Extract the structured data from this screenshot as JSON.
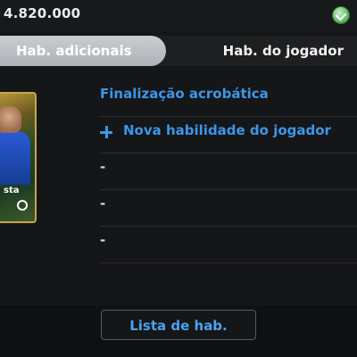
{
  "header": {
    "coins": "4.820.000",
    "coin_icon": "gp-coin-icon"
  },
  "tabs": [
    {
      "label": "Hab. adicionais",
      "active": true
    },
    {
      "label": "Hab. do jogador",
      "active": false
    }
  ],
  "player_card": {
    "name_fragment": "sta"
  },
  "skills": {
    "equipped": "Finalização acrobática",
    "add_label": "Nova habilidade do jogador",
    "empty_slots": [
      "-",
      "-",
      "-"
    ]
  },
  "footer": {
    "list_button": "Lista de hab."
  },
  "colors": {
    "accent_blue": "#3d96e8",
    "active_tab": "#b8bcc1",
    "background": "#151618"
  }
}
